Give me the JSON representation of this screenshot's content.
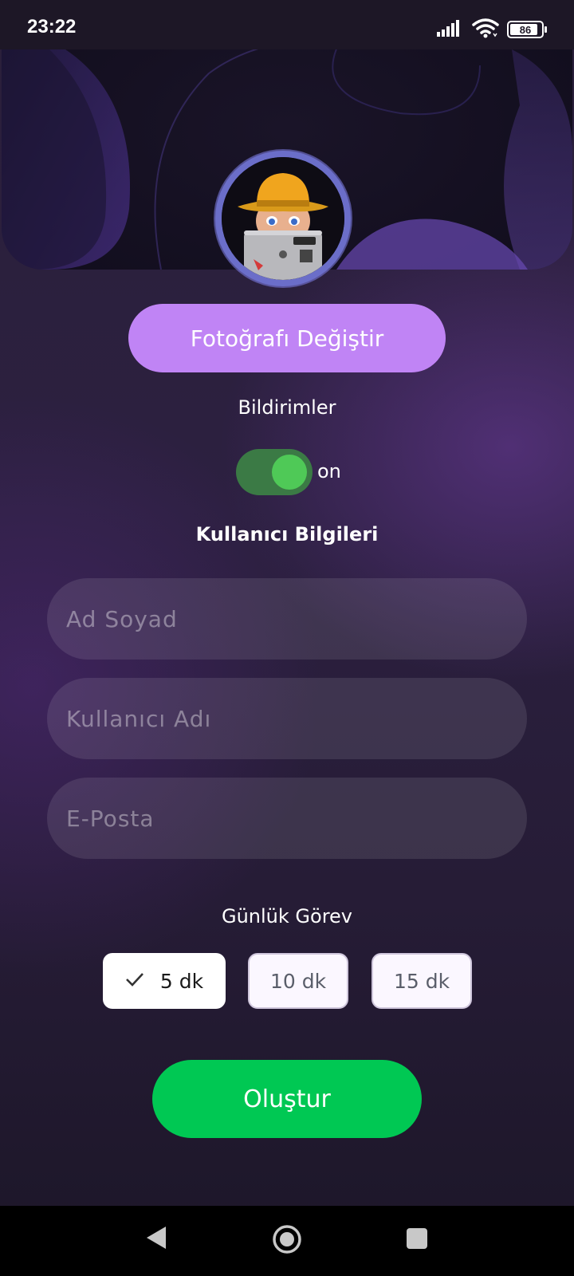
{
  "status_bar": {
    "time": "23:22",
    "battery": "86",
    "icons": [
      "signal-icon",
      "wifi-icon",
      "battery-icon"
    ]
  },
  "profile": {
    "avatar": "memoji-avatar",
    "change_photo_label": "Fotoğrafı Değiştir"
  },
  "notifications": {
    "label": "Bildirimler",
    "toggle_state": "on",
    "enabled": true
  },
  "user_info": {
    "title": "Kullanıcı Bilgileri",
    "fields": [
      {
        "placeholder": "Ad Soyad",
        "value": ""
      },
      {
        "placeholder": "Kullanıcı Adı",
        "value": ""
      },
      {
        "placeholder": "E-Posta",
        "value": ""
      }
    ]
  },
  "daily_task": {
    "label": "Günlük Görev",
    "options": [
      "5 dk",
      "10 dk",
      "15 dk"
    ],
    "selected": "5 dk"
  },
  "create_button_label": "Oluştur",
  "colors": {
    "accent_purple": "#c084f5",
    "toggle_on": "#4fc957",
    "create_green": "#00c853"
  },
  "nav_bar": {
    "icons": [
      "back-icon",
      "home-icon",
      "recents-icon"
    ]
  }
}
